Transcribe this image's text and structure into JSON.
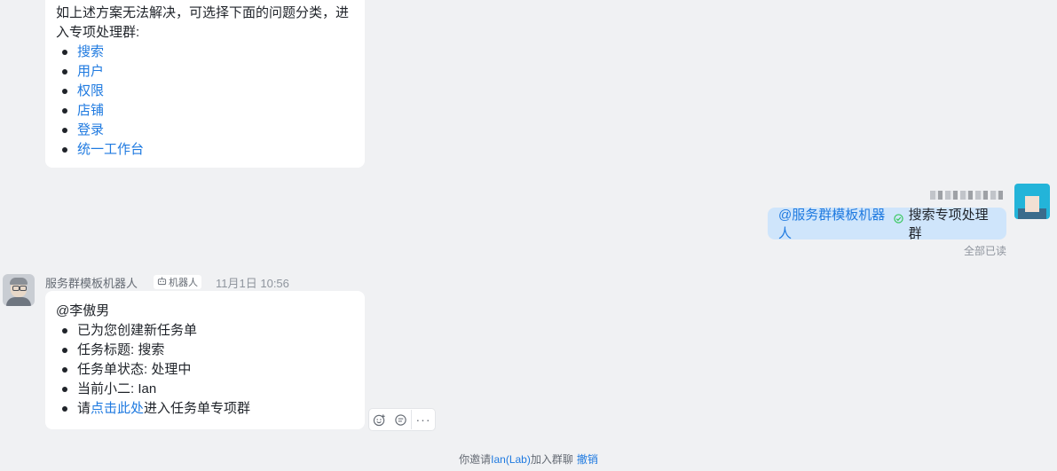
{
  "message1": {
    "intro": "如上述方案无法解决，可选择下面的问题分类，进入专项处理群:",
    "links": [
      "搜索",
      "用户",
      "权限",
      "店铺",
      "登录",
      "统一工作台"
    ]
  },
  "self_message": {
    "mention": "@服务群模板机器人",
    "text": "搜索专项处理群",
    "read_status": "全部已读"
  },
  "bot": {
    "name": "服务群模板机器人",
    "tag": "机器人",
    "time": "11月1日 10:56"
  },
  "message2": {
    "mention": "@李傲男",
    "items": [
      "已为您创建新任务单",
      "任务标题: 搜索",
      "任务单状态: 处理中",
      "当前小二: Ian"
    ],
    "last_prefix": "请",
    "last_link": "点击此处",
    "last_suffix": "进入任务单专项群"
  },
  "actions": {
    "icons": [
      "add-reaction-icon",
      "reply-icon",
      "more-icon"
    ],
    "more_label": "···"
  },
  "system": {
    "prefix": "你邀请",
    "name": "Ian(Lab)",
    "suffix": "加入群聊",
    "undo": "撤销"
  },
  "colors": {
    "link": "#1f7ae0",
    "self_bubble": "#cfe5fb",
    "background": "#f0f1f3"
  }
}
